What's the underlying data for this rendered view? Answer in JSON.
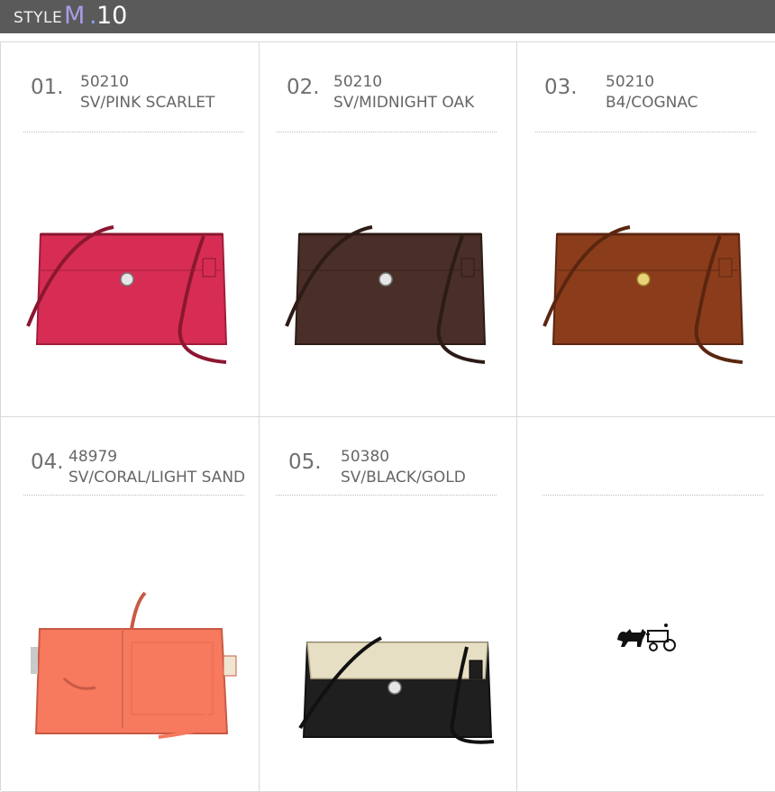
{
  "header": {
    "style": "STYLE",
    "m": "M",
    "dot": ".",
    "num": "10"
  },
  "items": [
    {
      "index": "01.",
      "code": "50210",
      "color": "SV/PINK SCARLET",
      "swatch": "#d72d55",
      "hardware": "silver"
    },
    {
      "index": "02.",
      "code": "50210",
      "color": "SV/MIDNIGHT OAK",
      "swatch": "#4a2f28",
      "hardware": "silver"
    },
    {
      "index": "03.",
      "code": "50210",
      "color": "B4/COGNAC",
      "swatch": "#8b3d1b",
      "hardware": "brass"
    },
    {
      "index": "04.",
      "code": "48979",
      "color": "SV/CORAL/LIGHT SAND",
      "swatch": "#f7795e",
      "hardware": "silver"
    },
    {
      "index": "05.",
      "code": "50380",
      "color": "SV/BLACK/GOLD",
      "swatch": "#1f1f1f",
      "hardware": "silver"
    }
  ],
  "logo_icon": "horse-and-carriage-logo"
}
